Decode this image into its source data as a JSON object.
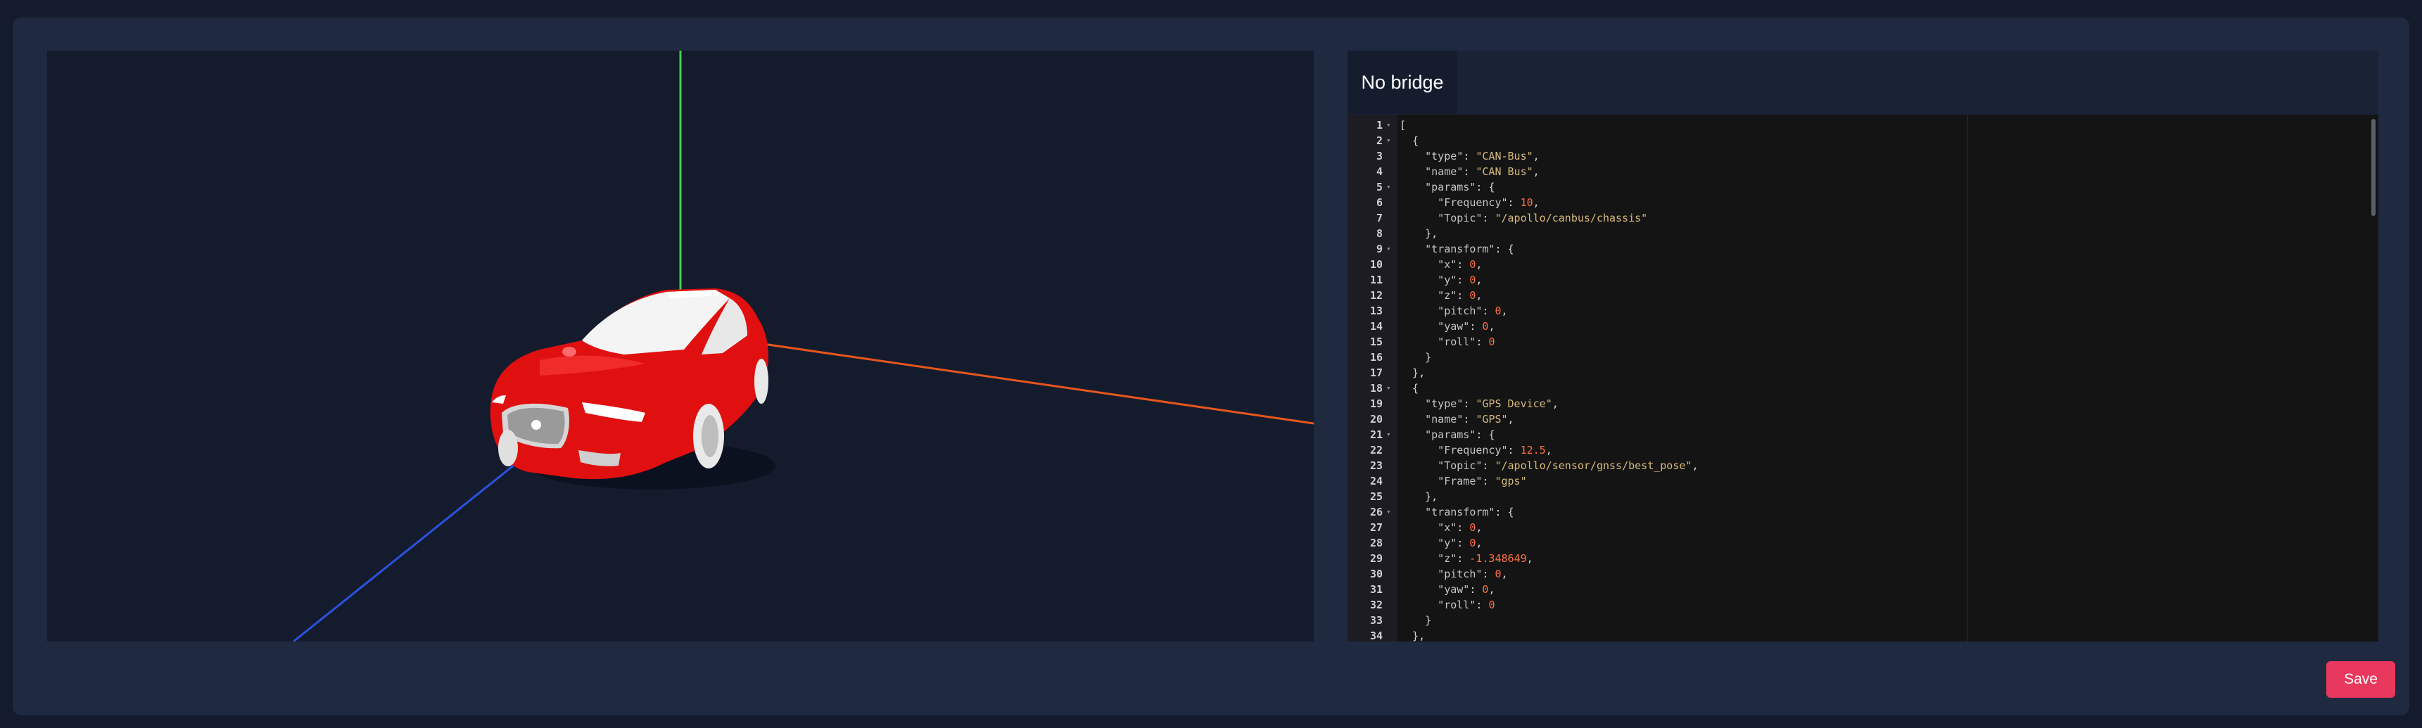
{
  "bridge_tab": {
    "label": "No bridge"
  },
  "save_button": {
    "label": "Save"
  },
  "scene": {
    "axis_colors": {
      "x": "#e8561d",
      "y": "#3fd64a",
      "z": "#2a52e0"
    },
    "vehicle_color": "#e01010",
    "background": "#141b2d"
  },
  "editor": {
    "theme": "dark",
    "lines": [
      [
        [
          "p",
          "["
        ]
      ],
      [
        [
          "p",
          "  {"
        ]
      ],
      [
        [
          "k",
          "    \"type\""
        ],
        [
          "p",
          ": "
        ],
        [
          "s",
          "\"CAN-Bus\""
        ],
        [
          "p",
          ","
        ]
      ],
      [
        [
          "k",
          "    \"name\""
        ],
        [
          "p",
          ": "
        ],
        [
          "s",
          "\"CAN Bus\""
        ],
        [
          "p",
          ","
        ]
      ],
      [
        [
          "k",
          "    \"params\""
        ],
        [
          "p",
          ": {"
        ]
      ],
      [
        [
          "k",
          "      \"Frequency\""
        ],
        [
          "p",
          ": "
        ],
        [
          "n",
          "10"
        ],
        [
          "p",
          ","
        ]
      ],
      [
        [
          "k",
          "      \"Topic\""
        ],
        [
          "p",
          ": "
        ],
        [
          "s",
          "\"/apollo/canbus/chassis\""
        ]
      ],
      [
        [
          "p",
          "    },"
        ]
      ],
      [
        [
          "k",
          "    \"transform\""
        ],
        [
          "p",
          ": {"
        ]
      ],
      [
        [
          "k",
          "      \"x\""
        ],
        [
          "p",
          ": "
        ],
        [
          "n",
          "0"
        ],
        [
          "p",
          ","
        ]
      ],
      [
        [
          "k",
          "      \"y\""
        ],
        [
          "p",
          ": "
        ],
        [
          "n",
          "0"
        ],
        [
          "p",
          ","
        ]
      ],
      [
        [
          "k",
          "      \"z\""
        ],
        [
          "p",
          ": "
        ],
        [
          "n",
          "0"
        ],
        [
          "p",
          ","
        ]
      ],
      [
        [
          "k",
          "      \"pitch\""
        ],
        [
          "p",
          ": "
        ],
        [
          "n",
          "0"
        ],
        [
          "p",
          ","
        ]
      ],
      [
        [
          "k",
          "      \"yaw\""
        ],
        [
          "p",
          ": "
        ],
        [
          "n",
          "0"
        ],
        [
          "p",
          ","
        ]
      ],
      [
        [
          "k",
          "      \"roll\""
        ],
        [
          "p",
          ": "
        ],
        [
          "n",
          "0"
        ]
      ],
      [
        [
          "p",
          "    }"
        ]
      ],
      [
        [
          "p",
          "  },"
        ]
      ],
      [
        [
          "p",
          "  {"
        ]
      ],
      [
        [
          "k",
          "    \"type\""
        ],
        [
          "p",
          ": "
        ],
        [
          "s",
          "\"GPS Device\""
        ],
        [
          "p",
          ","
        ]
      ],
      [
        [
          "k",
          "    \"name\""
        ],
        [
          "p",
          ": "
        ],
        [
          "s",
          "\"GPS\""
        ],
        [
          "p",
          ","
        ]
      ],
      [
        [
          "k",
          "    \"params\""
        ],
        [
          "p",
          ": {"
        ]
      ],
      [
        [
          "k",
          "      \"Frequency\""
        ],
        [
          "p",
          ": "
        ],
        [
          "n",
          "12.5"
        ],
        [
          "p",
          ","
        ]
      ],
      [
        [
          "k",
          "      \"Topic\""
        ],
        [
          "p",
          ": "
        ],
        [
          "s",
          "\"/apollo/sensor/gnss/best_pose\""
        ],
        [
          "p",
          ","
        ]
      ],
      [
        [
          "k",
          "      \"Frame\""
        ],
        [
          "p",
          ": "
        ],
        [
          "s",
          "\"gps\""
        ]
      ],
      [
        [
          "p",
          "    },"
        ]
      ],
      [
        [
          "k",
          "    \"transform\""
        ],
        [
          "p",
          ": {"
        ]
      ],
      [
        [
          "k",
          "      \"x\""
        ],
        [
          "p",
          ": "
        ],
        [
          "n",
          "0"
        ],
        [
          "p",
          ","
        ]
      ],
      [
        [
          "k",
          "      \"y\""
        ],
        [
          "p",
          ": "
        ],
        [
          "n",
          "0"
        ],
        [
          "p",
          ","
        ]
      ],
      [
        [
          "k",
          "      \"z\""
        ],
        [
          "p",
          ": "
        ],
        [
          "n",
          "-1.348649"
        ],
        [
          "p",
          ","
        ]
      ],
      [
        [
          "k",
          "      \"pitch\""
        ],
        [
          "p",
          ": "
        ],
        [
          "n",
          "0"
        ],
        [
          "p",
          ","
        ]
      ],
      [
        [
          "k",
          "      \"yaw\""
        ],
        [
          "p",
          ": "
        ],
        [
          "n",
          "0"
        ],
        [
          "p",
          ","
        ]
      ],
      [
        [
          "k",
          "      \"roll\""
        ],
        [
          "p",
          ": "
        ],
        [
          "n",
          "0"
        ]
      ],
      [
        [
          "p",
          "    }"
        ]
      ],
      [
        [
          "p",
          "  },"
        ]
      ]
    ],
    "foldable_lines": [
      1,
      2,
      5,
      9,
      18,
      21,
      26
    ]
  }
}
